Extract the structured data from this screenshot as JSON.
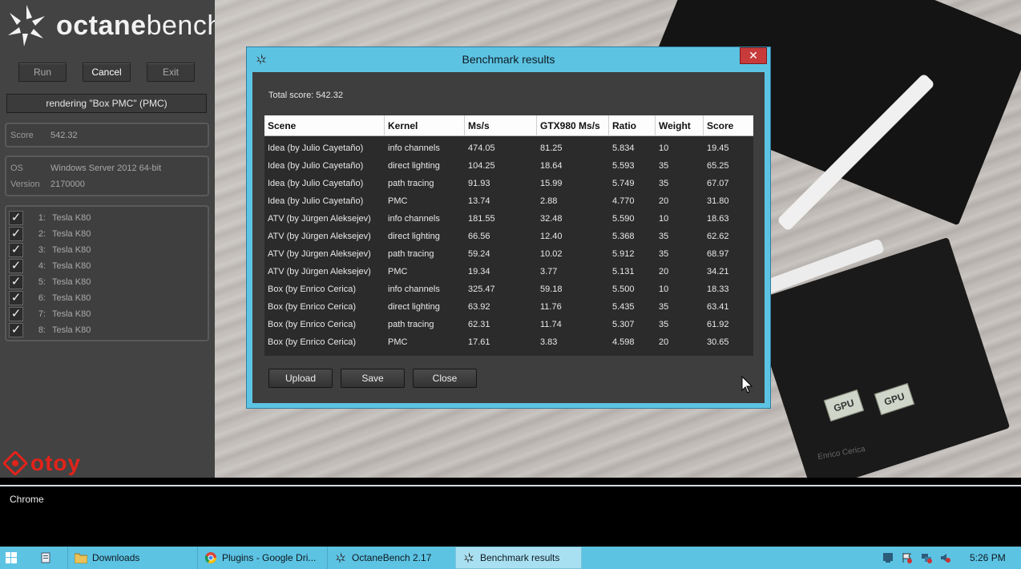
{
  "app": {
    "logo_text_bold": "octane",
    "logo_text_light": "bench",
    "run_label": "Run",
    "cancel_label": "Cancel",
    "exit_label": "Exit",
    "status": "rendering \"Box PMC\" (PMC)",
    "score_label": "Score",
    "score_value": "542.32",
    "os_label": "OS",
    "os_value": "Windows Server 2012 64-bit",
    "version_label": "Version",
    "version_value": "2170000",
    "gpus": [
      {
        "num": "1:",
        "name": "Tesla K80",
        "checked": true
      },
      {
        "num": "2:",
        "name": "Tesla K80",
        "checked": true
      },
      {
        "num": "3:",
        "name": "Tesla K80",
        "checked": true
      },
      {
        "num": "4:",
        "name": "Tesla K80",
        "checked": true
      },
      {
        "num": "5:",
        "name": "Tesla K80",
        "checked": true
      },
      {
        "num": "6:",
        "name": "Tesla K80",
        "checked": true
      },
      {
        "num": "7:",
        "name": "Tesla K80",
        "checked": true
      },
      {
        "num": "8:",
        "name": "Tesla K80",
        "checked": true
      }
    ],
    "brand_text": "otoy"
  },
  "render": {
    "chip_labels": [
      "GPU",
      "GPU"
    ],
    "signature": "Enrico Cerica"
  },
  "console": {
    "text": "Chrome"
  },
  "dialog": {
    "title": "Benchmark results",
    "close_glyph": "✕",
    "total_score": "Total score: 542.32",
    "columns": [
      "Scene",
      "Kernel",
      "Ms/s",
      "GTX980 Ms/s",
      "Ratio",
      "Weight",
      "Score"
    ],
    "rows": [
      [
        "Idea (by Julio Cayetaño)",
        "info channels",
        "474.05",
        "81.25",
        "5.834",
        "10",
        "19.45"
      ],
      [
        "Idea (by Julio Cayetaño)",
        "direct lighting",
        "104.25",
        "18.64",
        "5.593",
        "35",
        "65.25"
      ],
      [
        "Idea (by Julio Cayetaño)",
        "path tracing",
        "91.93",
        "15.99",
        "5.749",
        "35",
        "67.07"
      ],
      [
        "Idea (by Julio Cayetaño)",
        "PMC",
        "13.74",
        "2.88",
        "4.770",
        "20",
        "31.80"
      ],
      [
        "ATV (by Jürgen Aleksejev)",
        "info channels",
        "181.55",
        "32.48",
        "5.590",
        "10",
        "18.63"
      ],
      [
        "ATV (by Jürgen Aleksejev)",
        "direct lighting",
        "66.56",
        "12.40",
        "5.368",
        "35",
        "62.62"
      ],
      [
        "ATV (by Jürgen Aleksejev)",
        "path tracing",
        "59.24",
        "10.02",
        "5.912",
        "35",
        "68.97"
      ],
      [
        "ATV (by Jürgen Aleksejev)",
        "PMC",
        "19.34",
        "3.77",
        "5.131",
        "20",
        "34.21"
      ],
      [
        "Box (by Enrico Cerica)",
        "info channels",
        "325.47",
        "59.18",
        "5.500",
        "10",
        "18.33"
      ],
      [
        "Box (by Enrico Cerica)",
        "direct lighting",
        "63.92",
        "11.76",
        "5.435",
        "35",
        "63.41"
      ],
      [
        "Box (by Enrico Cerica)",
        "path tracing",
        "62.31",
        "11.74",
        "5.307",
        "35",
        "61.92"
      ],
      [
        "Box (by Enrico Cerica)",
        "PMC",
        "17.61",
        "3.83",
        "4.598",
        "20",
        "30.65"
      ]
    ],
    "upload_label": "Upload",
    "save_label": "Save",
    "close_label": "Close"
  },
  "taskbar": {
    "items": [
      {
        "label": "Downloads",
        "icon": "folder-icon"
      },
      {
        "label": "Plugins - Google Dri...",
        "icon": "chrome-icon"
      },
      {
        "label": "OctaneBench 2.17",
        "icon": "octane-icon"
      },
      {
        "label": "Benchmark results",
        "icon": "octane-icon"
      }
    ],
    "clock": "5:26 PM"
  },
  "colors": {
    "accent": "#5dc3e3",
    "close_red": "#c73b3b",
    "brand_red": "#e2231a",
    "panel_bg": "#434343"
  }
}
